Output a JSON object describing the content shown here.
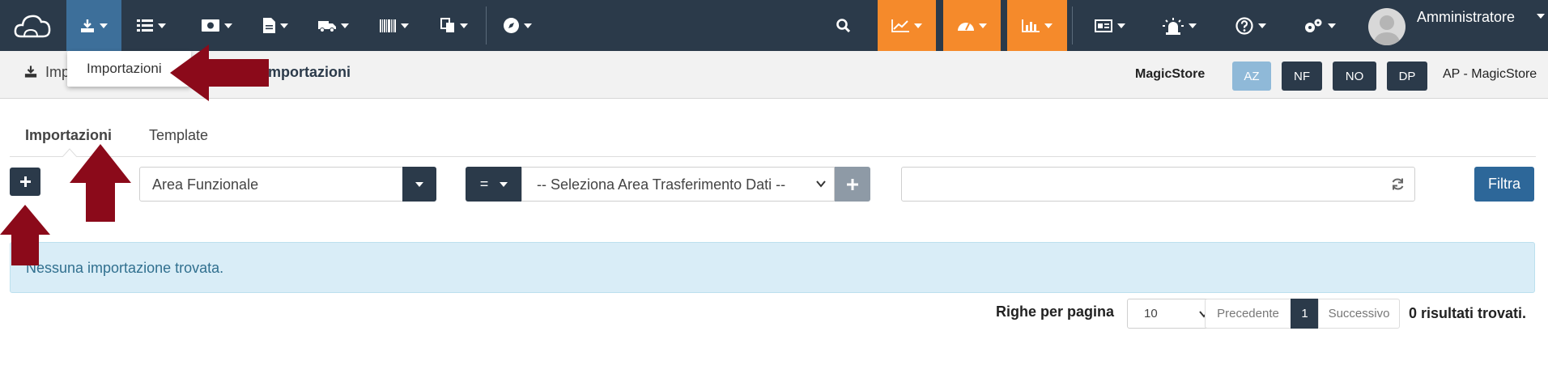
{
  "navbar": {
    "user_name": "Amministratore",
    "items": [
      {
        "icon": "download-icon",
        "active": true
      },
      {
        "icon": "list-icon"
      },
      {
        "icon": "money-icon"
      },
      {
        "icon": "document-icon"
      },
      {
        "icon": "truck-icon"
      },
      {
        "icon": "barcode-icon"
      },
      {
        "icon": "copy-icon"
      },
      {
        "icon": "compass-icon"
      },
      {
        "icon": "search-icon"
      },
      {
        "icon": "line-chart-icon",
        "color": "#f58a2b"
      },
      {
        "icon": "dashboard-icon",
        "color": "#f58a2b"
      },
      {
        "icon": "bar-chart-icon",
        "color": "#f58a2b"
      },
      {
        "icon": "id-card-icon"
      },
      {
        "icon": "alarm-icon"
      },
      {
        "icon": "help-icon"
      },
      {
        "icon": "gears-icon"
      }
    ]
  },
  "dropdown": {
    "item": "Importazioni"
  },
  "subheader": {
    "crumb_partial": "Imp",
    "crumb_current": "Importazioni",
    "store_name": "MagicStore",
    "tags": [
      "AZ",
      "NF",
      "NO",
      "DP"
    ],
    "ap_label": "AP - MagicStore"
  },
  "tabs": [
    {
      "label": "Importazioni",
      "active": true
    },
    {
      "label": "Template",
      "active": false
    }
  ],
  "filters": {
    "area_funzionale": "Area Funzionale",
    "operator": "=",
    "area_trasferimento": "-- Seleziona Area Trasferimento Dati --",
    "search_value": "",
    "filter_button": "Filtra"
  },
  "alert": {
    "message": "Nessuna importazione trovata."
  },
  "pagination": {
    "rows_label": "Righe per pagina",
    "rows_value": "10",
    "prev": "Precedente",
    "current_page": "1",
    "next": "Successivo",
    "results": "0 risultati trovati."
  },
  "colors": {
    "navbar": "#2b3a4a",
    "active_tab": "#3d6f9a",
    "orange": "#f58a2b",
    "filter_button": "#2d6799",
    "alert_bg": "#d9edf7",
    "annotation_arrow": "#8b0a1a"
  }
}
